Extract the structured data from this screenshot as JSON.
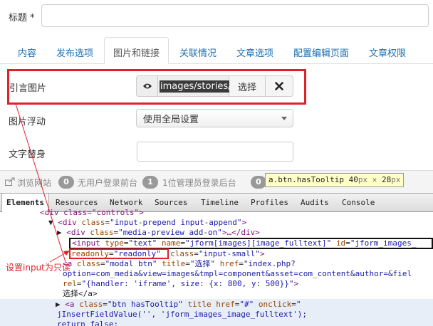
{
  "form": {
    "title_label": "标题 *",
    "tabs": [
      "内容",
      "发布选项",
      "图片和链接",
      "关联情况",
      "文章选项",
      "配置编辑页面",
      "文章权限"
    ],
    "active_tab": "图片和链接",
    "intro_image_label": "引言图片",
    "image_path": "images/stories/",
    "select_button": "选择",
    "float_label": "图片浮动",
    "float_value": "使用全局设置",
    "alt_label": "文字替身"
  },
  "status_bar": {
    "browse": "浏览网站",
    "frontend_count": "0",
    "frontend_text": "无用户登录前台",
    "backend_count": "1",
    "backend_text": "1位管理员登录后台",
    "third_count": "0"
  },
  "tooltip": {
    "selector": "a.btn.hasTooltip",
    "width": "40",
    "height": "28",
    "unit": "px",
    "times": "×"
  },
  "devtools": {
    "tabs": [
      "Elements",
      "Resources",
      "Network",
      "Sources",
      "Timeline",
      "Profiles",
      "Audits",
      "Console"
    ],
    "active_tab": "Elements",
    "lines": {
      "l0": "<div class=\"controls\">",
      "l1_tag": "<div",
      "l1_attr": "class",
      "l1_val": "\"input-prepend input-append\"",
      "l2_tag": "<div",
      "l2_attr": "class",
      "l2_val": "\"media-preview add-on\"",
      "l2_end": ">…</div>",
      "l3_a": "<input",
      "l3_b": "type",
      "l3_c": "\"text\"",
      "l3_d": "name",
      "l3_e": "\"jform[images][image_fulltext]\"",
      "l3_f": "id",
      "l3_g": "\"jform_images_",
      "l4_a": "readonly",
      "l4_b": "\"readonly\"",
      "l4_c": "class",
      "l4_d": "\"input-small\"",
      "l5_a": "<a",
      "l5_b": "class",
      "l5_c": "\"modal btn\"",
      "l5_d": "title",
      "l5_e": "\"选择\"",
      "l5_f": "href",
      "l5_g": "\"index.php?",
      "l6": "option=com_media&view=images&tmpl=component&asset=com_content&author=&fiel",
      "l7_a": "rel",
      "l7_b": "\"{handler: 'iframe', size: {x: 800, y: 500}}\"",
      "l8": "选择</a>",
      "l9_a": "<a",
      "l9_b": "class",
      "l9_c": "\"btn hasTooltip\"",
      "l9_d": "title",
      "l9_e": "href",
      "l9_f": "\"#\"",
      "l9_g": "onclick",
      "l10": "jInsertFieldValue('', 'jform_images_image_fulltext');",
      "l11": "return false;"
    }
  },
  "annotation": "设置input为只读",
  "colors": {
    "annotation_red": "#e0202a",
    "link_blue": "#1a6fb0",
    "tag_purple": "#881280",
    "attr_brown": "#994500",
    "value_blue": "#1a1aa6"
  }
}
